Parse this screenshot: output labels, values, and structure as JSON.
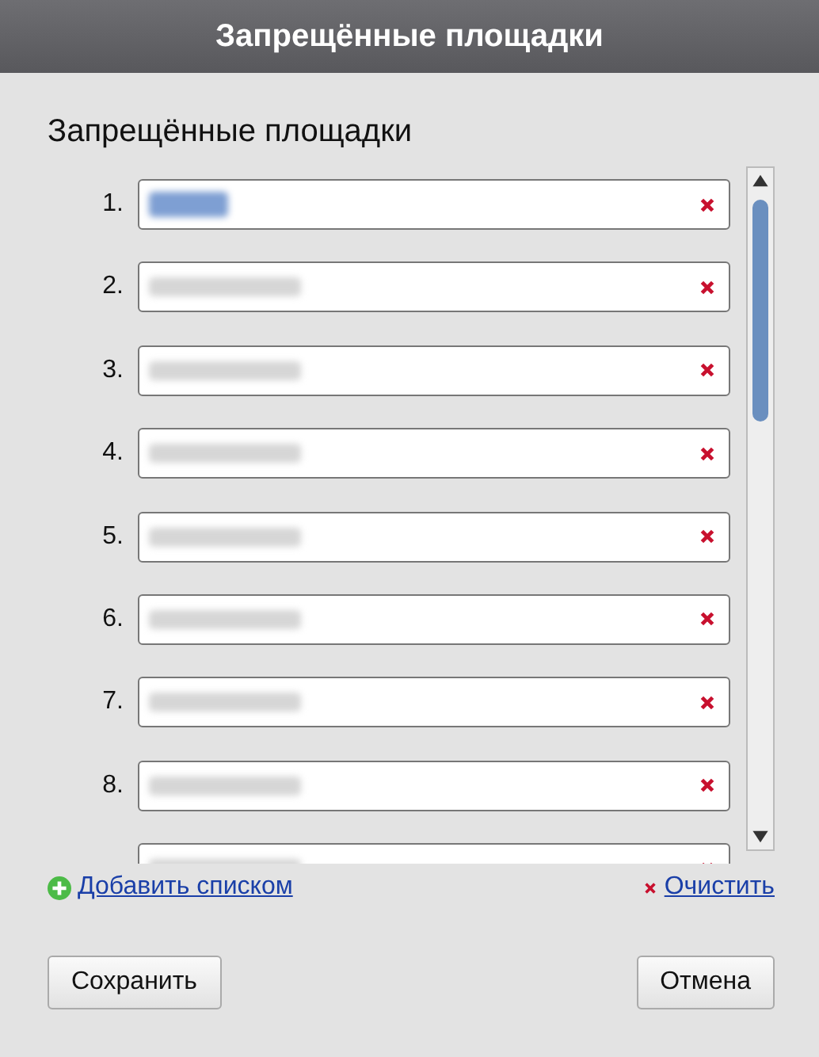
{
  "window": {
    "title": "Запрещённые площадки"
  },
  "heading": "Запрещённые площадки",
  "sites": [
    {
      "number": "1.",
      "highlighted": true
    },
    {
      "number": "2.",
      "highlighted": false
    },
    {
      "number": "3.",
      "highlighted": false
    },
    {
      "number": "4.",
      "highlighted": false
    },
    {
      "number": "5.",
      "highlighted": false
    },
    {
      "number": "6.",
      "highlighted": false
    },
    {
      "number": "7.",
      "highlighted": false
    },
    {
      "number": "8.",
      "highlighted": false
    },
    {
      "highlighted": false
    }
  ],
  "add_link": "Добавить списком",
  "clear_link": "Очистить",
  "buttons": [
    {
      "label": "Сохранить"
    },
    {
      "label": "Отмена"
    }
  ]
}
